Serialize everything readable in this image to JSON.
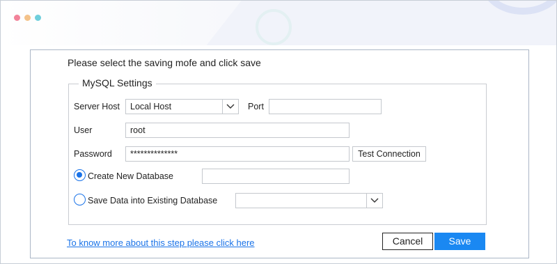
{
  "window": {
    "dots": [
      "close-dot",
      "minimize-dot",
      "maximize-dot"
    ]
  },
  "dialog": {
    "instruction": "Please select the saving mofe and click save",
    "group_title": "MySQL Settings",
    "server_host": {
      "label": "Server Host",
      "value": "Local Host"
    },
    "port": {
      "label": "Port",
      "value": ""
    },
    "user": {
      "label": "User",
      "value": "root"
    },
    "password": {
      "label": "Password",
      "value": "**************"
    },
    "test_connection_label": "Test Connection",
    "create_new_db": {
      "label": "Create New Database",
      "selected": true,
      "value": ""
    },
    "existing_db": {
      "label": "Save Data into Existing Database",
      "selected": false,
      "value": ""
    },
    "help_link": "To know more about this step please click here",
    "cancel_label": "Cancel",
    "save_label": "Save"
  },
  "colors": {
    "accent": "#1a88f2",
    "link": "#1a73e8",
    "radio": "#1a73e8"
  }
}
